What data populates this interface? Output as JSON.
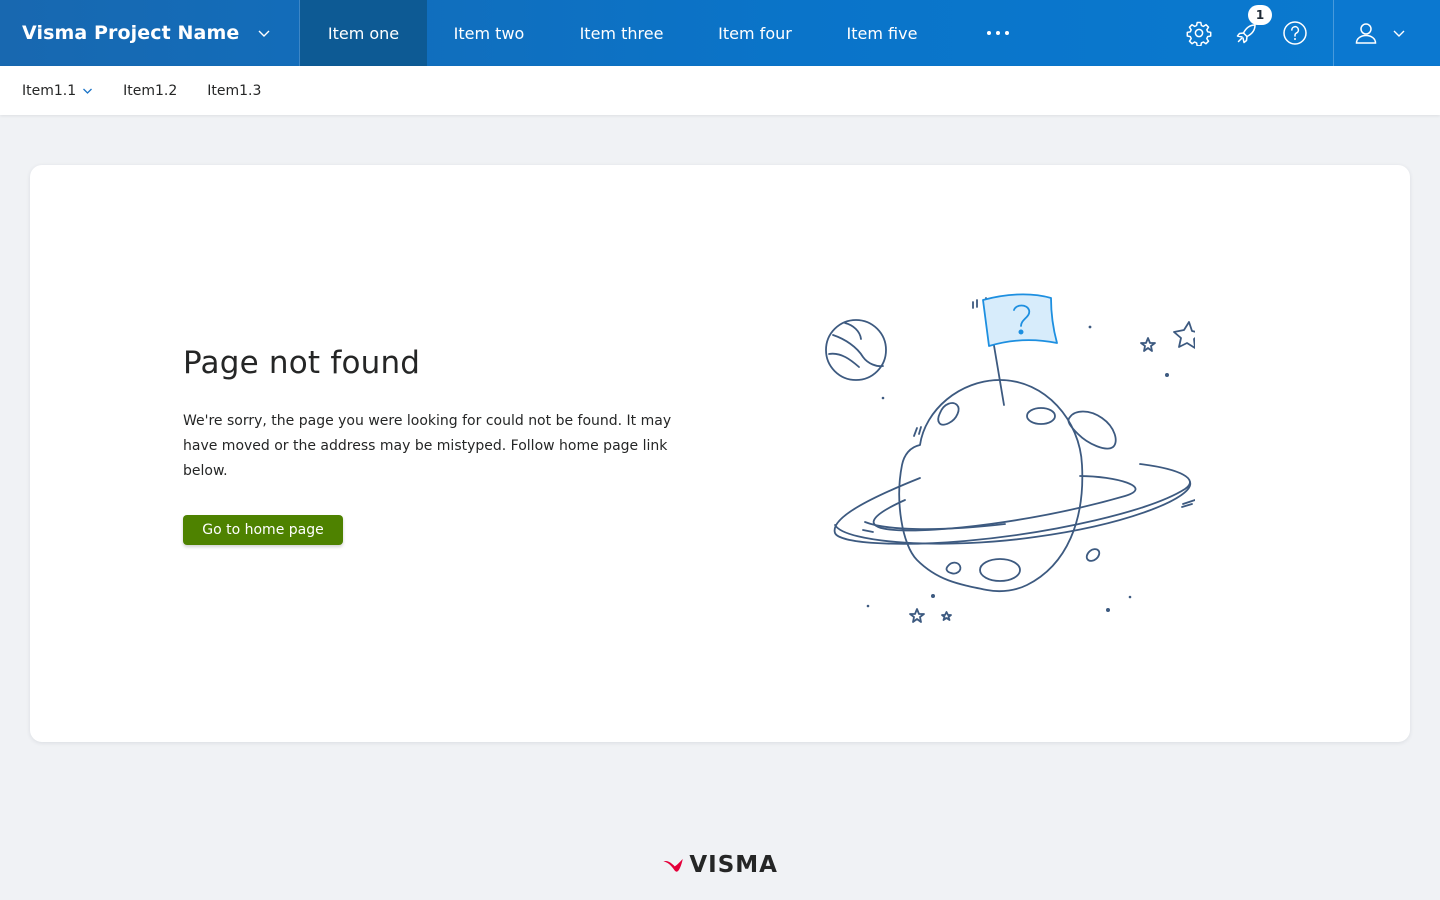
{
  "app": {
    "project_name": "Visma Project Name"
  },
  "nav": {
    "items": [
      {
        "label": "Item one",
        "active": true
      },
      {
        "label": "Item two",
        "active": false
      },
      {
        "label": "Item three",
        "active": false
      },
      {
        "label": "Item four",
        "active": false
      },
      {
        "label": "Item five",
        "active": false
      }
    ],
    "more_icon": "more-horizontal-icon"
  },
  "tools": {
    "settings_icon": "gear-icon",
    "notifications_icon": "rocket-icon",
    "notifications_count": "1",
    "help_icon": "help-circle-icon",
    "user_icon": "user-icon"
  },
  "subnav": {
    "items": [
      {
        "label": "Item1.1",
        "has_dropdown": true
      },
      {
        "label": "Item1.2",
        "has_dropdown": false
      },
      {
        "label": "Item1.3",
        "has_dropdown": false
      }
    ]
  },
  "error": {
    "title": "Page not found",
    "description": "We're sorry, the page you were looking for could not be found. It may have moved or the address may be mistyped. Follow home page link below.",
    "button_label": "Go to home page",
    "illustration": "planet-with-question-flag-illustration"
  },
  "footer": {
    "brand": "VISMA"
  },
  "colors": {
    "primary": "#0a74c9",
    "nav_active": "#0d5a94",
    "button": "#4e8200",
    "background": "#f0f2f5",
    "brand_red": "#e4003a"
  }
}
